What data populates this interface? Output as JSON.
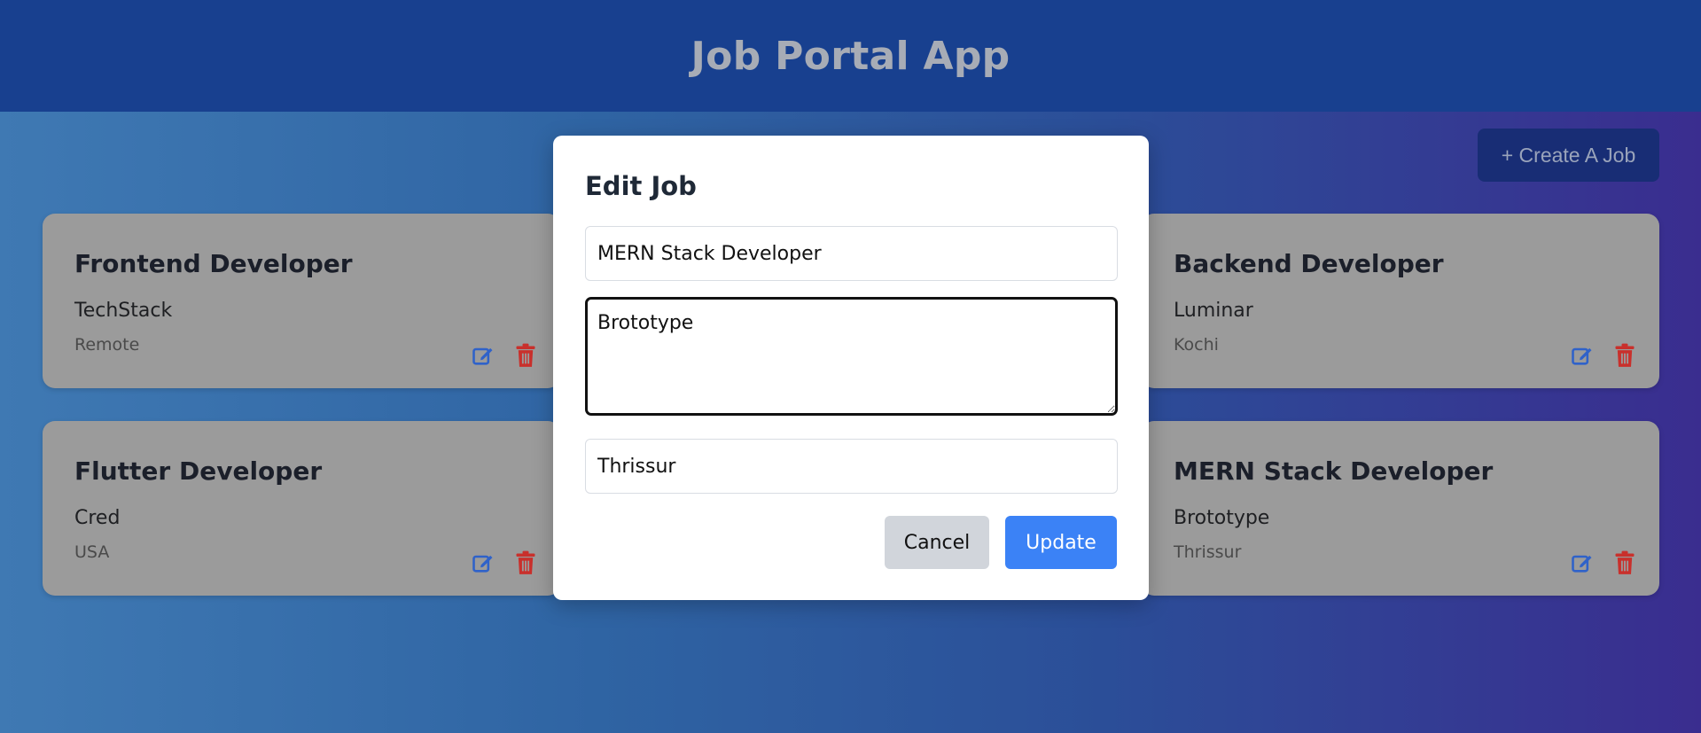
{
  "header": {
    "title": "Job Portal App"
  },
  "toolbar": {
    "create_label": "+ Create A Job"
  },
  "jobs": [
    {
      "title": "Frontend Developer",
      "company": "TechStack",
      "location": "Remote"
    },
    {
      "title": "Backend Developer",
      "company": "Luminar",
      "location": "Kochi"
    },
    {
      "title": "Flutter Developer",
      "company": "Cred",
      "location": "USA"
    },
    {
      "title": "MERN Stack Developer",
      "company": "Brototype",
      "location": "Thrissur"
    }
  ],
  "modal": {
    "title": "Edit Job",
    "title_value": "MERN Stack Developer",
    "company_value": "Brototype",
    "location_value": "Thrissur",
    "cancel_label": "Cancel",
    "update_label": "Update"
  },
  "icons": {
    "edit": "edit-icon",
    "delete": "trash-icon"
  },
  "colors": {
    "accent": "#3b82f6",
    "header": "#18408f",
    "edit_icon": "#2f62c9",
    "delete_icon": "#c9302c"
  }
}
